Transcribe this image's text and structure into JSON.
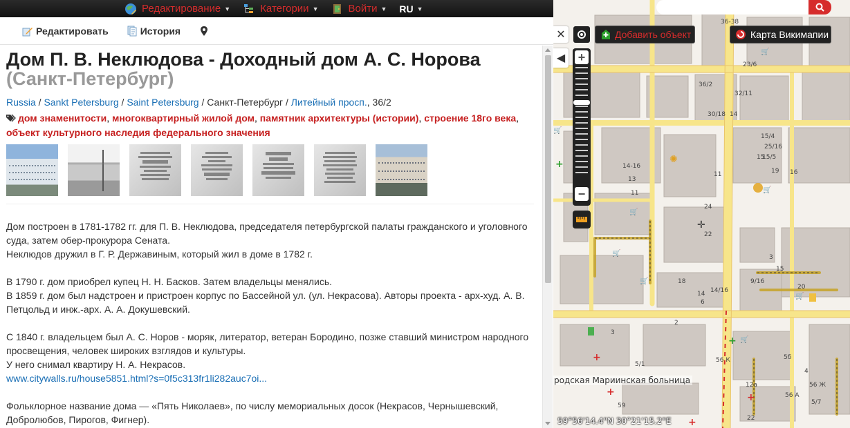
{
  "topbar": {
    "edit_label": "Редактирование",
    "categories_label": "Категории",
    "login_label": "Войти",
    "lang_label": "RU"
  },
  "actions": {
    "edit_label": "Редактировать",
    "history_label": "История"
  },
  "article": {
    "title": "Дом П. В. Неклюдова - Доходный дом А. С. Норова",
    "subtitle": "(Санкт-Петербург)",
    "breadcrumb": [
      {
        "label": "Russia",
        "link": true
      },
      {
        "label": "Sankt Petersburg",
        "link": true
      },
      {
        "label": "Saint Petersburg",
        "link": true
      },
      {
        "label": "Санкт-Петербург",
        "link": false
      },
      {
        "label": "Литейный просп.",
        "link": true
      }
    ],
    "house_number": ", 36/2",
    "tags": [
      "дом знаменитости",
      "многоквартирный жилой дом",
      "памятник архитектуры (истории)",
      "строение 18го века",
      "объект культурного наследия федерального значения"
    ],
    "thumbnails": [
      {
        "kind": "photo",
        "icon": "building-photo"
      },
      {
        "kind": "photo-old",
        "icon": "historic-photo"
      },
      {
        "kind": "plaque",
        "icon": "memorial-plaque"
      },
      {
        "kind": "plaque",
        "icon": "memorial-plaque"
      },
      {
        "kind": "plaque",
        "icon": "memorial-plaque"
      },
      {
        "kind": "plaque",
        "icon": "memorial-plaque"
      },
      {
        "kind": "photo",
        "icon": "building-photo"
      }
    ],
    "paragraphs": [
      [
        "Дом построен в 1781-1782 гг. для П. В. Неклюдова, председателя петербургской палаты гражданского и уголовного суда, затем обер-прокурора Сената.",
        "Неклюдов дружил в Г. Р. Державиным, который жил в доме в 1782 г."
      ],
      [
        "В 1790 г. дом приобрел купец Н. Н. Басков. Затем владельцы менялись.",
        "В 1859 г. дом был надстроен и пристроен корпус по Бассейной ул. (ул. Некрасова). Авторы проекта - арх-худ. А. В. Петцольд и инж.-арх. А. А. Докушевский."
      ],
      [
        "С 1840 г. владельцем был А. С. Норов - моряк, литератор, ветеран Бородино, позже ставший министром народного просвещения, человек широких взглядов и культуры.",
        "У него снимал квартиру Н. А. Некрасов."
      ],
      [
        "Фольклорное название дома — «Пять Николаев», по числу мемориальных досок (Некрасов, Чернышевский, Добролюбов, Пирогов, Фигнер)."
      ]
    ],
    "source_link": "www.citywalls.ru/house5851.html?s=0f5c313fr1li282auc7oi..."
  },
  "map": {
    "search_placeholder": "",
    "add_object_label": "Добавить объект",
    "wikimap_label": "Карта Викимапии",
    "coords": "59°56'14.4\"N 30°21'15.2\"E",
    "hospital_label": "родская Мариинская больница",
    "labels": [
      "36-38",
      "23/6",
      "32/11",
      "14",
      "30/18",
      "15/4",
      "25/16",
      "15",
      "15/5",
      "16",
      "11",
      "19",
      "14-16",
      "13",
      "11",
      "24",
      "22",
      "18",
      "14",
      "6",
      "3",
      "15",
      "9/16",
      "20",
      "14/16",
      "2",
      "3",
      "56 К",
      "12а",
      "5/1",
      "56 А",
      "59",
      "56 Ж",
      "5б",
      "5/7",
      "4",
      "22",
      "36/2"
    ],
    "colors": {
      "accent": "#d62c2c",
      "road": "#f7e58a",
      "building": "#cfc8c2",
      "block": "#f4f1ec"
    }
  }
}
